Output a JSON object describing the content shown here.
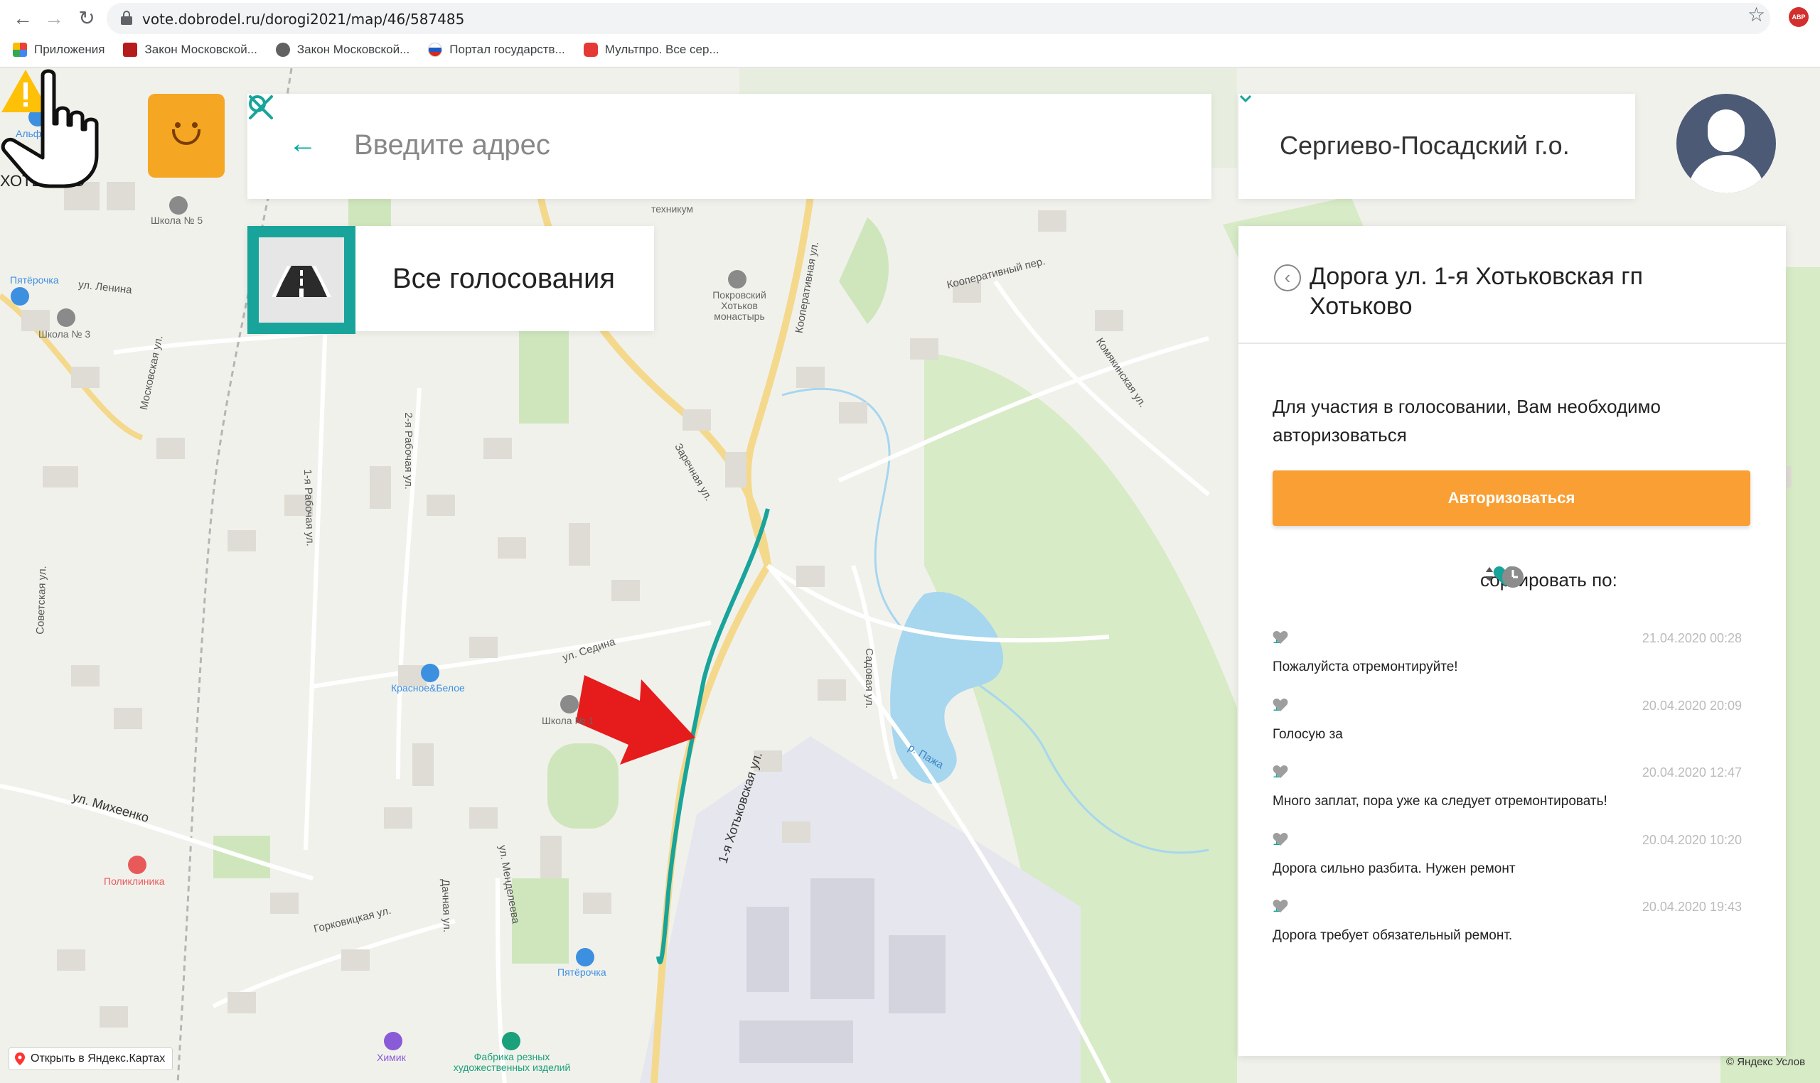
{
  "browser": {
    "url": "vote.dobrodel.ru/dorogi2021/map/46/587485",
    "bookmarks": [
      {
        "label": "Приложения",
        "color": "#4285f4"
      },
      {
        "label": "Закон Московской...",
        "color": "#b71c1c"
      },
      {
        "label": "Закон Московской...",
        "color": "#616161"
      },
      {
        "label": "Портал государств...",
        "color": "#1e5bc6"
      },
      {
        "label": "Мультпро. Все сер...",
        "color": "#e53935"
      }
    ]
  },
  "search": {
    "placeholder": "Введите адрес"
  },
  "district": {
    "label": "Сергиево-Посадский г.о."
  },
  "all_votes": {
    "label": "Все голосования"
  },
  "detail": {
    "title": "Дорога ул. 1-я Хотьковская гп Хотьково",
    "auth_text": "Для участия в голосовании, Вам необходимо авторизоваться",
    "auth_button": "Авторизоваться",
    "sort_label": "сортировать по:",
    "accent_color": "#19a49b",
    "button_color": "#f99f33"
  },
  "comments": [
    {
      "likes": "1",
      "date": "21.04.2020 00:28",
      "text": "Пожалуйста отремонтируйте!"
    },
    {
      "likes": "1",
      "date": "20.04.2020 20:09",
      "text": "Голосую за"
    },
    {
      "likes": "1",
      "date": "20.04.2020 12:47",
      "text": "Много заплат, пора уже ка следует отремонтировать!"
    },
    {
      "likes": "1",
      "date": "20.04.2020 10:20",
      "text": "Дорога сильно разбита. Нужен ремонт"
    },
    {
      "likes": "1",
      "date": "20.04.2020 19:43",
      "text": "Дорога требует обязательный ремонт."
    }
  ],
  "map": {
    "open_yandex": "Открыть в Яндекс.Картах",
    "copyright": "© Яндекс Услов",
    "streets": [
      {
        "text": "1-я Хотьковская ул."
      },
      {
        "text": "ул. Седина"
      },
      {
        "text": "ул. Михеенко"
      },
      {
        "text": "Кооперативная ул."
      },
      {
        "text": "Садовая ул."
      },
      {
        "text": "р. Пажа"
      },
      {
        "text": "ул. Ленина"
      },
      {
        "text": "Горковицкая ул."
      },
      {
        "text": "2-я Рабочая ул."
      },
      {
        "text": "1-я Рабочая ул."
      },
      {
        "text": "Заречная ул."
      },
      {
        "text": "Кооперативный пер."
      },
      {
        "text": "Московская ул."
      },
      {
        "text": "Советская ул."
      },
      {
        "text": "ул. Менделеева"
      },
      {
        "text": "Дачная ул."
      },
      {
        "text": "Комякинская ул."
      },
      {
        "text": "ХОТЬКОВО"
      }
    ],
    "pois": [
      {
        "text": "Пятёрочка",
        "color": "#3d8fe0"
      },
      {
        "text": "Альфрей",
        "color": "#3d8fe0"
      },
      {
        "text": "Школа № 5",
        "color": "#8a8a8a"
      },
      {
        "text": "Школа № 3",
        "color": "#8a8a8a"
      },
      {
        "text": "Школа № 1",
        "color": "#8a8a8a"
      },
      {
        "text": "Красное&Белое",
        "color": "#3d8fe0"
      },
      {
        "text": "Поликлиника",
        "color": "#e85a5a"
      },
      {
        "text": "Пятёрочка",
        "color": "#3d8fe0"
      },
      {
        "text": "Химик",
        "color": "#8a5bd6"
      },
      {
        "text": "Фабрика резных художественных изделий",
        "color": "#1aa07a"
      },
      {
        "text": "Покровский Хотьков монастырь",
        "color": "#8a8a8a"
      },
      {
        "text": "техникум",
        "color": "#8a8a8a"
      }
    ]
  }
}
